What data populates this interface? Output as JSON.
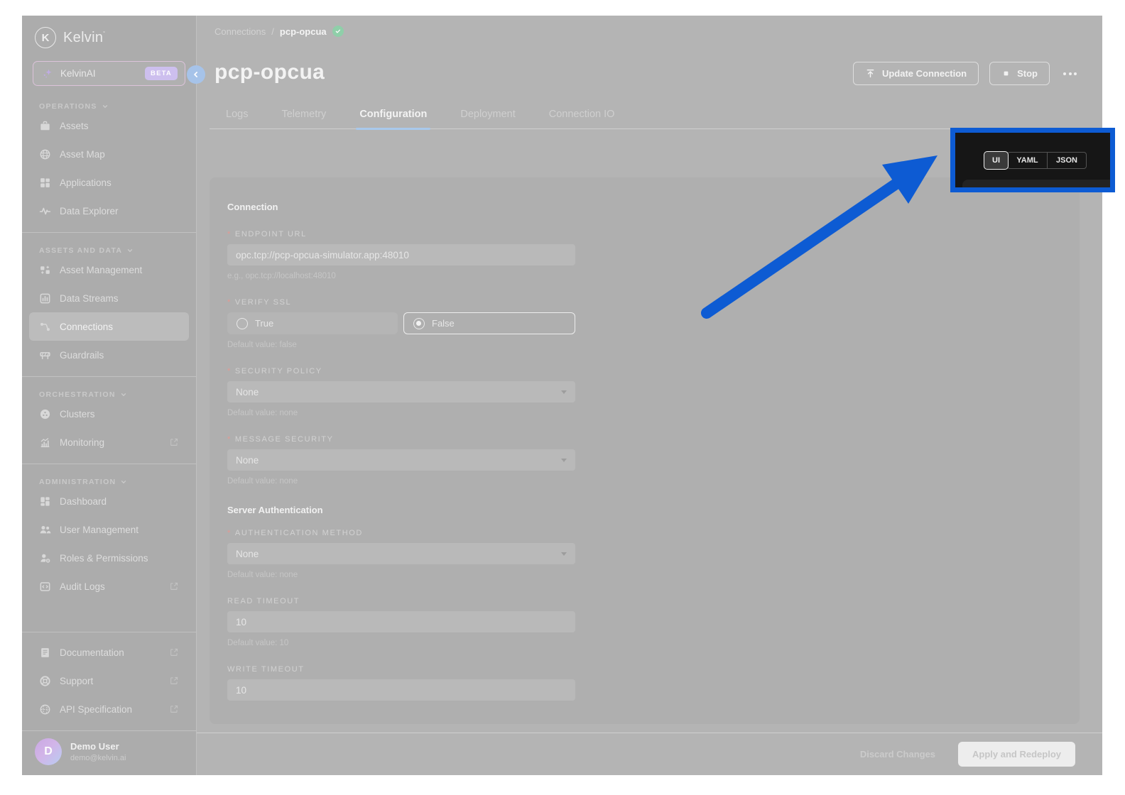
{
  "brand": {
    "logo_letter": "K",
    "name": "Kelvin",
    "mark": "˚"
  },
  "sidebar": {
    "ai_item": {
      "label": "KelvinAI",
      "badge": "BETA"
    },
    "sections": [
      {
        "label": "OPERATIONS",
        "items": [
          {
            "label": "Assets"
          },
          {
            "label": "Asset Map"
          },
          {
            "label": "Applications"
          },
          {
            "label": "Data Explorer"
          }
        ]
      },
      {
        "label": "ASSETS AND DATA",
        "items": [
          {
            "label": "Asset Management"
          },
          {
            "label": "Data Streams"
          },
          {
            "label": "Connections"
          },
          {
            "label": "Guardrails"
          }
        ]
      },
      {
        "label": "ORCHESTRATION",
        "items": [
          {
            "label": "Clusters"
          },
          {
            "label": "Monitoring"
          }
        ]
      },
      {
        "label": "ADMINISTRATION",
        "items": [
          {
            "label": "Dashboard"
          },
          {
            "label": "User Management"
          },
          {
            "label": "Roles & Permissions"
          },
          {
            "label": "Audit Logs"
          }
        ]
      }
    ],
    "footer_items": [
      {
        "label": "Documentation"
      },
      {
        "label": "Support"
      },
      {
        "label": "API Specification"
      }
    ],
    "user": {
      "initial": "D",
      "name": "Demo User",
      "email": "demo@kelvin.ai"
    }
  },
  "header": {
    "breadcrumb_root": "Connections",
    "breadcrumb_sep": "/",
    "breadcrumb_current": "pcp-opcua",
    "title": "pcp-opcua",
    "update_button": "Update Connection",
    "stop_button": "Stop"
  },
  "tabs": {
    "items": [
      "Logs",
      "Telemetry",
      "Configuration",
      "Deployment",
      "Connection IO"
    ],
    "active": "Configuration"
  },
  "view_toggle": {
    "options": [
      "UI",
      "YAML",
      "JSON"
    ],
    "selected": "UI"
  },
  "form": {
    "section1_title": "Connection",
    "endpoint": {
      "required": "*",
      "label": "ENDPOINT URL",
      "value": "opc.tcp://pcp-opcua-simulator.app:48010",
      "hint": "e.g., opc.tcp://localhost:48010"
    },
    "verify_ssl": {
      "required": "*",
      "label": "VERIFY SSL",
      "option_true": "True",
      "option_false": "False",
      "selected": "False",
      "hint": "Default value: false"
    },
    "security_policy": {
      "required": "*",
      "label": "SECURITY POLICY",
      "value": "None",
      "hint": "Default value: none"
    },
    "message_security": {
      "required": "*",
      "label": "MESSAGE SECURITY",
      "value": "None",
      "hint": "Default value: none"
    },
    "section2_title": "Server Authentication",
    "auth_method": {
      "required": "*",
      "label": "AUTHENTICATION METHOD",
      "value": "None",
      "hint": "Default value: none"
    },
    "read_timeout": {
      "label": "READ TIMEOUT",
      "value": "10",
      "hint": "Default value: 10"
    },
    "write_timeout": {
      "label": "WRITE TIMEOUT",
      "value": "10"
    }
  },
  "footer": {
    "discard_label": "Discard Changes",
    "apply_label": "Apply and Redeploy"
  },
  "colors": {
    "highlight_blue": "#0d5bd3",
    "tab_underline": "#a9c9ec",
    "status_green": "#8fcfa9",
    "beta_purple": "#cdbfee"
  }
}
